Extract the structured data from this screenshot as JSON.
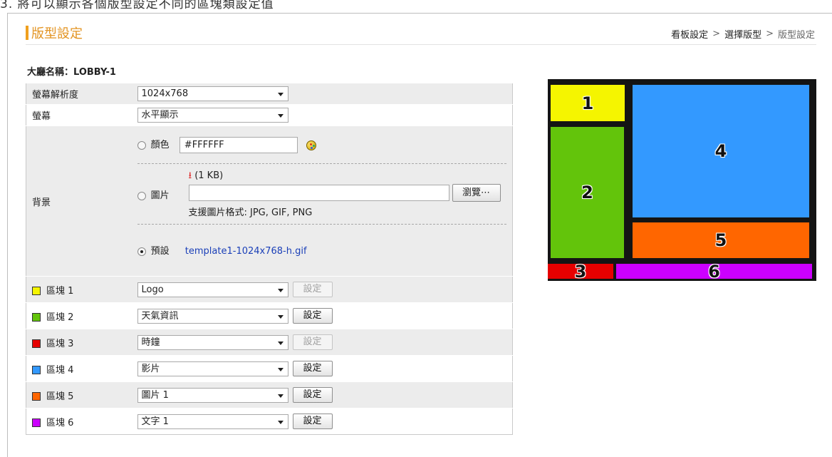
{
  "caption": "3. 將可以顯示各個版型設定不同的區塊類設定值",
  "header": {
    "title": "版型設定",
    "breadcrumb": [
      "看板設定",
      "選擇版型",
      "版型設定"
    ],
    "separator": ">"
  },
  "hall": {
    "label": "大廳名稱：",
    "name": "LOBBY-1"
  },
  "resolution": {
    "label": "螢幕解析度",
    "value": "1024x768"
  },
  "screen": {
    "label": "螢幕",
    "value": "水平顯示"
  },
  "background": {
    "label": "背景",
    "color_option": {
      "label": "顏色",
      "value": "#FFFFFF",
      "checked": false
    },
    "image_option": {
      "label": "圖片",
      "size_text": "(1 KB)",
      "file_value": "",
      "browse_label": "瀏覽⋯",
      "formats_text": "支援圖片格式: JPG, GIF, PNG",
      "checked": false
    },
    "default_option": {
      "label": "預設",
      "file": "template1-1024x768-h.gif",
      "checked": true
    }
  },
  "blocks": [
    {
      "label": "區塊 1",
      "color": "#f5f500",
      "value": "Logo",
      "button": "設定",
      "button_enabled": false
    },
    {
      "label": "區塊 2",
      "color": "#63c40b",
      "value": "天氣資訊",
      "button": "設定",
      "button_enabled": true
    },
    {
      "label": "區塊 3",
      "color": "#e60000",
      "value": "時鐘",
      "button": "設定",
      "button_enabled": false
    },
    {
      "label": "區塊 4",
      "color": "#3399ff",
      "value": "影片",
      "button": "設定",
      "button_enabled": true
    },
    {
      "label": "區塊 5",
      "color": "#ff6600",
      "value": "圖片 1",
      "button": "設定",
      "button_enabled": true
    },
    {
      "label": "區塊 6",
      "color": "#cc00ff",
      "value": "文字 1",
      "button": "設定",
      "button_enabled": true
    }
  ],
  "preview": {
    "zones": [
      {
        "number": "1",
        "color": "#f5f500"
      },
      {
        "number": "2",
        "color": "#63c40b"
      },
      {
        "number": "3",
        "color": "#e60000"
      },
      {
        "number": "4",
        "color": "#3399ff"
      },
      {
        "number": "5",
        "color": "#ff6600"
      },
      {
        "number": "6",
        "color": "#cc00ff"
      }
    ]
  }
}
